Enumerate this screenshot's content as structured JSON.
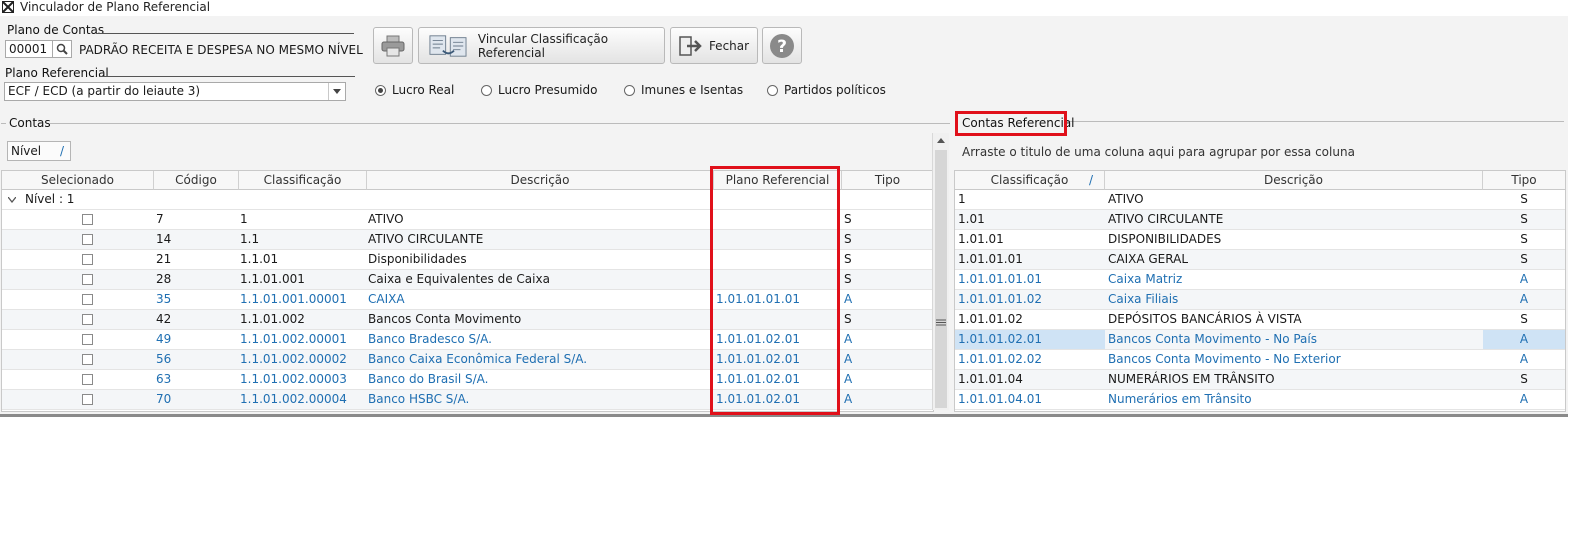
{
  "window": {
    "title": "Vinculador de Plano Referencial"
  },
  "plano_contas": {
    "label": "Plano de Contas",
    "code": "00001",
    "name": "PADRÃO RECEITA E DESPESA NO MESMO NÍVEL"
  },
  "plano_referencial": {
    "label": "Plano Referencial",
    "selected": "ECF / ECD (a partir do leiaute 3)"
  },
  "toolbar": {
    "vincular_label": "Vincular Classificação Referencial",
    "fechar_label": "Fechar"
  },
  "radios": [
    {
      "label": "Lucro Real",
      "checked": true
    },
    {
      "label": "Lucro Presumido",
      "checked": false
    },
    {
      "label": "Imunes e Isentas",
      "checked": false
    },
    {
      "label": "Partidos políticos",
      "checked": false
    }
  ],
  "contas": {
    "title": "Contas",
    "group_chip": "Nível",
    "group_row": "Nível : 1",
    "columns": [
      "Selecionado",
      "Código",
      "Classificação",
      "Descrição",
      "Plano Referencial",
      "Tipo"
    ],
    "rows": [
      {
        "codigo": "7",
        "classificacao": "1",
        "descricao": "ATIVO",
        "plano": "",
        "tipo": "S",
        "blue": false
      },
      {
        "codigo": "14",
        "classificacao": "1.1",
        "descricao": "ATIVO CIRCULANTE",
        "plano": "",
        "tipo": "S",
        "blue": false
      },
      {
        "codigo": "21",
        "classificacao": "1.1.01",
        "descricao": "Disponibilidades",
        "plano": "",
        "tipo": "S",
        "blue": false
      },
      {
        "codigo": "28",
        "classificacao": "1.1.01.001",
        "descricao": "Caixa e Equivalentes de Caixa",
        "plano": "",
        "tipo": "S",
        "blue": false
      },
      {
        "codigo": "35",
        "classificacao": "1.1.01.001.00001",
        "descricao": "CAIXA",
        "plano": "1.01.01.01.01",
        "tipo": "A",
        "blue": true
      },
      {
        "codigo": "42",
        "classificacao": "1.1.01.002",
        "descricao": "Bancos Conta Movimento",
        "plano": "",
        "tipo": "S",
        "blue": false
      },
      {
        "codigo": "49",
        "classificacao": "1.1.01.002.00001",
        "descricao": "Banco Bradesco S/A.",
        "plano": "1.01.01.02.01",
        "tipo": "A",
        "blue": true
      },
      {
        "codigo": "56",
        "classificacao": "1.1.01.002.00002",
        "descricao": "Banco Caixa Econômica Federal S/A.",
        "plano": "1.01.01.02.01",
        "tipo": "A",
        "blue": true
      },
      {
        "codigo": "63",
        "classificacao": "1.1.01.002.00003",
        "descricao": "Banco do Brasil S/A.",
        "plano": "1.01.01.02.01",
        "tipo": "A",
        "blue": true
      },
      {
        "codigo": "70",
        "classificacao": "1.1.01.002.00004",
        "descricao": "Banco HSBC S/A.",
        "plano": "1.01.01.02.01",
        "tipo": "A",
        "blue": true
      }
    ]
  },
  "contas_referencial": {
    "title": "Contas Referencial",
    "group_hint": "Arraste o titulo de uma coluna aqui para agrupar por essa coluna",
    "columns": [
      "Classificação",
      "Descrição",
      "Tipo"
    ],
    "rows": [
      {
        "classificacao": "1",
        "descricao": "ATIVO",
        "tipo": "S",
        "blue": false,
        "selected": false
      },
      {
        "classificacao": "1.01",
        "descricao": "ATIVO CIRCULANTE",
        "tipo": "S",
        "blue": false,
        "selected": false
      },
      {
        "classificacao": "1.01.01",
        "descricao": "DISPONIBILIDADES",
        "tipo": "S",
        "blue": false,
        "selected": false
      },
      {
        "classificacao": "1.01.01.01",
        "descricao": "CAIXA GERAL",
        "tipo": "S",
        "blue": false,
        "selected": false
      },
      {
        "classificacao": "1.01.01.01.01",
        "descricao": "Caixa Matriz",
        "tipo": "A",
        "blue": true,
        "selected": false
      },
      {
        "classificacao": "1.01.01.01.02",
        "descricao": "Caixa Filiais",
        "tipo": "A",
        "blue": true,
        "selected": false
      },
      {
        "classificacao": "1.01.01.02",
        "descricao": "DEPÓSITOS BANCÁRIOS À VISTA",
        "tipo": "S",
        "blue": false,
        "selected": false
      },
      {
        "classificacao": "1.01.01.02.01",
        "descricao": "Bancos Conta Movimento - No País",
        "tipo": "A",
        "blue": true,
        "selected": true
      },
      {
        "classificacao": "1.01.01.02.02",
        "descricao": "Bancos Conta Movimento - No Exterior",
        "tipo": "A",
        "blue": true,
        "selected": false
      },
      {
        "classificacao": "1.01.01.04",
        "descricao": "NUMERÁRIOS EM TRÂNSITO",
        "tipo": "S",
        "blue": false,
        "selected": false
      },
      {
        "classificacao": "1.01.01.04.01",
        "descricao": "Numerários em Trânsito",
        "tipo": "A",
        "blue": true,
        "selected": false
      }
    ]
  },
  "colors": {
    "highlight": "#e0101a",
    "link_blue": "#1f6fb2",
    "selected_row": "#cfe3f5"
  }
}
